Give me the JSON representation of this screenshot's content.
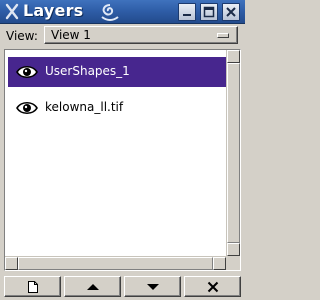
{
  "window": {
    "title": "Layers",
    "controls": [
      "minimize",
      "maximize",
      "close"
    ]
  },
  "view": {
    "label": "View:",
    "selected": "View 1"
  },
  "layers": [
    {
      "name": "UserShapes_1",
      "visible_icon": "eye-icon",
      "selected": true
    },
    {
      "name": "kelowna_ll.tif",
      "visible_icon": "eye-icon",
      "selected": false
    }
  ],
  "toolbar": {
    "buttons": [
      "new-layer-icon",
      "move-up-icon",
      "move-down-icon",
      "delete-icon"
    ]
  },
  "colors": {
    "titlebar": "#2f5ea8",
    "selection": "#47268e",
    "chrome": "#d4d0c8"
  }
}
